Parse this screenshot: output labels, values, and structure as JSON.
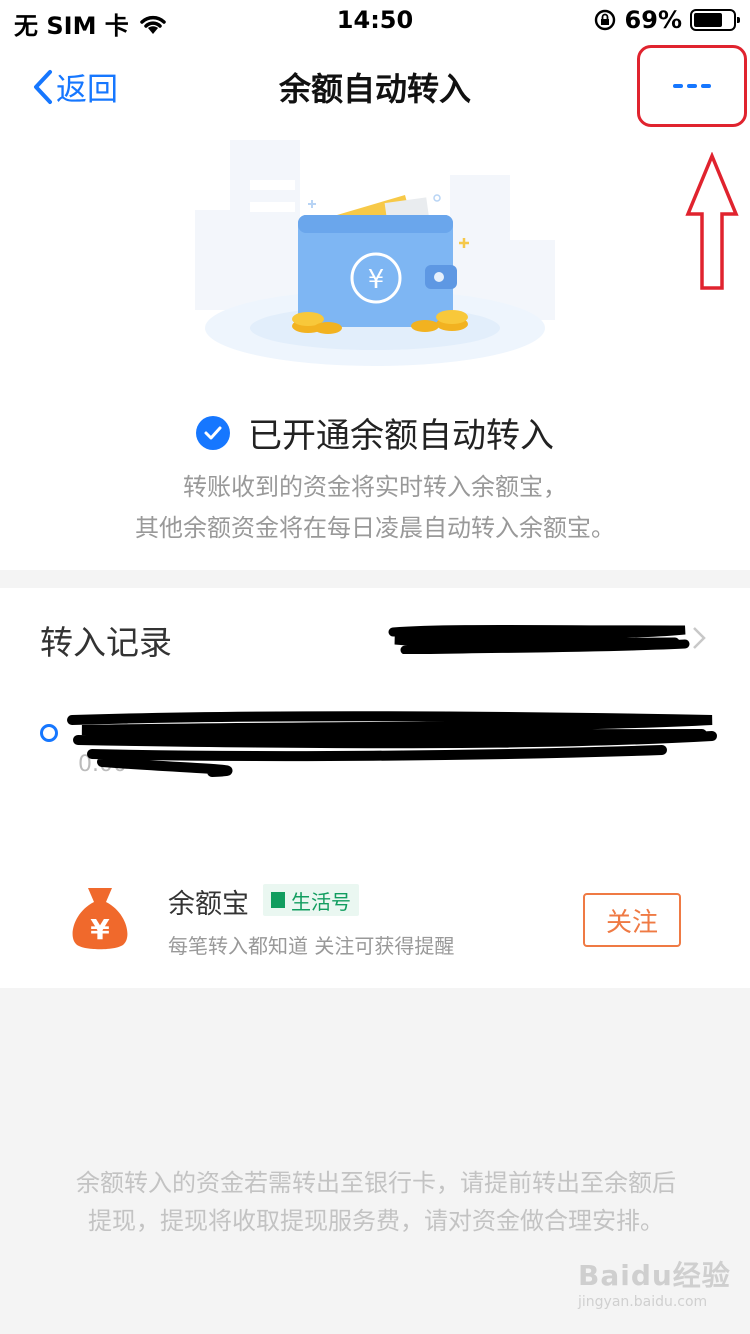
{
  "status_bar": {
    "carrier": "无 SIM 卡",
    "time": "14:50",
    "battery": "69%"
  },
  "nav": {
    "back_label": "返回",
    "title": "余额自动转入",
    "more_label": "···"
  },
  "hero": {
    "status_text": "已开通余额自动转入",
    "desc_line1": "转账收到的资金将实时转入余额宝，",
    "desc_line2": "其他余额资金将在每日凌晨自动转入余额宝。"
  },
  "records": {
    "title": "转入记录",
    "redacted_value": "0.00"
  },
  "service": {
    "name": "余额宝",
    "badge": "生活号",
    "desc": "每笔转入都知道  关注可获得提醒",
    "follow_label": "关注"
  },
  "footer": {
    "note": "余额转入的资金若需转出至银行卡，请提前转出至余额后提现，提现将收取提现服务费，请对资金做合理安排。"
  },
  "watermark": {
    "main": "Baidu经验",
    "sub": "jingyan.baidu.com"
  },
  "colors": {
    "accent": "#1677ff",
    "highlight": "#e0232e",
    "follow": "#ef7a44",
    "badge_green": "#119d5f"
  }
}
